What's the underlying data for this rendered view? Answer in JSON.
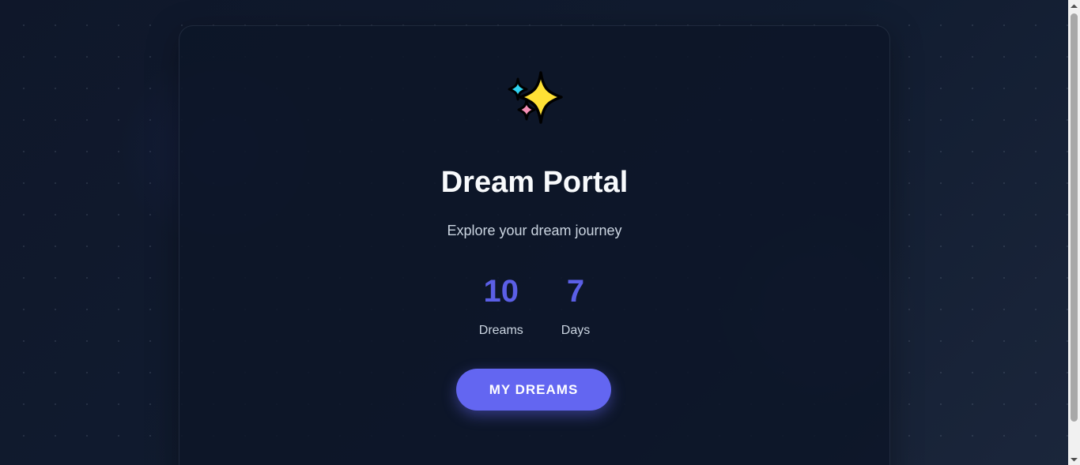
{
  "colors": {
    "background": "#0f172a",
    "card": "#0d1628",
    "accent": "#6366f1",
    "stat_value": "#5b5fe6",
    "title": "#f8fafc",
    "muted_text": "#cbd5e1"
  },
  "logo": {
    "icon": "sparkles-icon"
  },
  "hero": {
    "title": "Dream Portal",
    "subtitle": "Explore your dream journey"
  },
  "stats": [
    {
      "value": "10",
      "label": "Dreams"
    },
    {
      "value": "7",
      "label": "Days"
    }
  ],
  "cta": {
    "label": "MY DREAMS"
  }
}
